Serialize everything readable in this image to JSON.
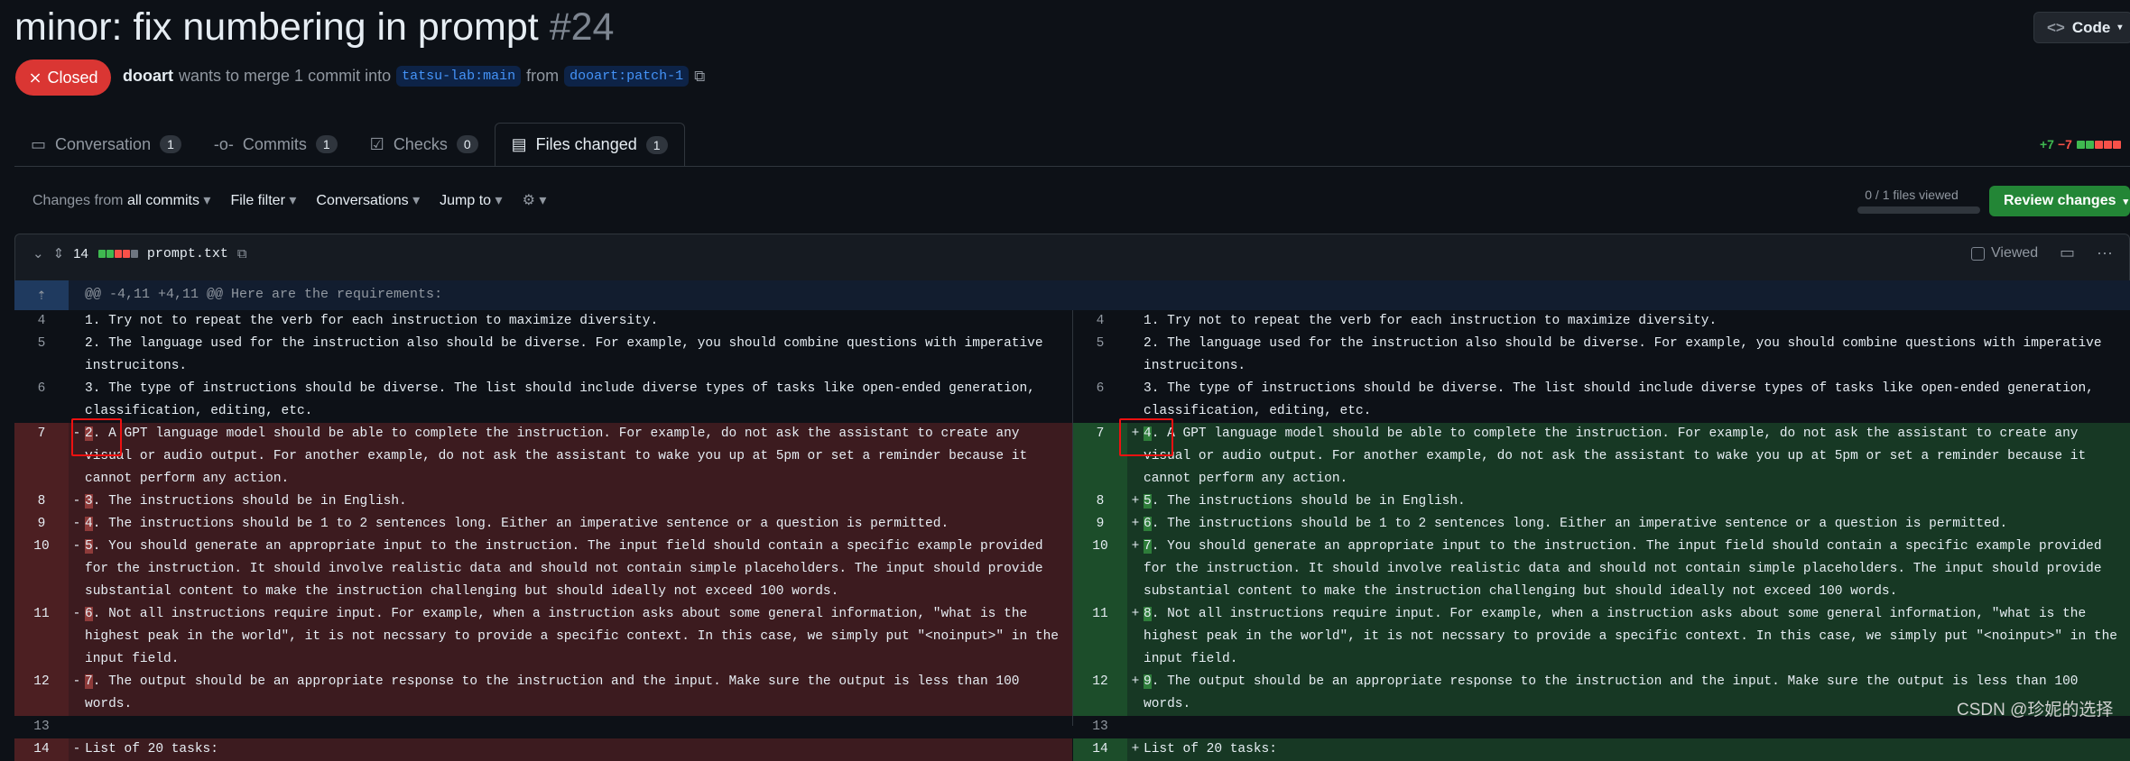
{
  "pr": {
    "title": "minor: fix numbering in prompt",
    "number": "#24",
    "state": "Closed",
    "author": "dooart",
    "merge_text": "wants to merge 1 commit into",
    "base": "tatsu-lab:main",
    "from_text": "from",
    "head": "dooart:patch-1",
    "code_label": "Code"
  },
  "tabs": [
    {
      "label": "Conversation",
      "count": "1"
    },
    {
      "label": "Commits",
      "count": "1"
    },
    {
      "label": "Checks",
      "count": "0"
    },
    {
      "label": "Files changed",
      "count": "1"
    }
  ],
  "diffstat": {
    "added": "+7",
    "removed": "−7"
  },
  "toolbar": {
    "changes_from": "Changes from",
    "all_commits": "all commits",
    "file_filter": "File filter",
    "conversations": "Conversations",
    "jump_to": "Jump to",
    "files_viewed": "0 / 1 files viewed",
    "review": "Review changes"
  },
  "file": {
    "changes": "14",
    "name": "prompt.txt",
    "viewed": "Viewed"
  },
  "hunk": "@@ -4,11 +4,11 @@ Here are the requirements:",
  "left": [
    {
      "type": "ctx",
      "ln": "4",
      "sign": "",
      "pre": "",
      "hl": "",
      "text": "1. Try not to repeat the verb for each instruction to maximize diversity."
    },
    {
      "type": "ctx",
      "ln": "5",
      "sign": "",
      "pre": "",
      "hl": "",
      "text": "2. The language used for the instruction also should be diverse. For example, you should combine questions with imperative instrucitons."
    },
    {
      "type": "ctx",
      "ln": "6",
      "sign": "",
      "pre": "",
      "hl": "",
      "text": "3. The type of instructions should be diverse. The list should include diverse types of tasks like open-ended generation, classification, editing, etc."
    },
    {
      "type": "del",
      "ln": "7",
      "sign": "-",
      "pre": "",
      "hl": "2",
      "text": ". A GPT language model should be able to complete the instruction. For example, do not ask the assistant to create any visual or audio output. For another example, do not ask the assistant to wake you up at 5pm or set a reminder because it cannot perform any action."
    },
    {
      "type": "del",
      "ln": "8",
      "sign": "-",
      "pre": "",
      "hl": "3",
      "text": ". The instructions should be in English."
    },
    {
      "type": "del",
      "ln": "9",
      "sign": "-",
      "pre": "",
      "hl": "4",
      "text": ". The instructions should be 1 to 2 sentences long. Either an imperative sentence or a question is permitted."
    },
    {
      "type": "del",
      "ln": "10",
      "sign": "-",
      "pre": "",
      "hl": "5",
      "text": ". You should generate an appropriate input to the instruction. The input field should contain a specific example provided for the instruction. It should involve realistic data and should not contain simple placeholders. The input should provide substantial content to make the instruction challenging but should ideally not exceed 100 words."
    },
    {
      "type": "del",
      "ln": "11",
      "sign": "-",
      "pre": "",
      "hl": "6",
      "text": ". Not all instructions require input. For example, when a instruction asks about some general information, \"what is the highest peak in the world\", it is not necssary to provide a specific context. In this case, we simply put \"<noinput>\" in the input field."
    },
    {
      "type": "del",
      "ln": "12",
      "sign": "-",
      "pre": "",
      "hl": "7",
      "text": ". The output should be an appropriate response to the instruction and the input. Make sure the output is less than 100 words."
    },
    {
      "type": "ctx",
      "ln": "13",
      "sign": "",
      "pre": "",
      "hl": "",
      "text": ""
    },
    {
      "type": "del",
      "ln": "14",
      "sign": "-",
      "pre": "",
      "hl": "",
      "text": "List of 20 tasks:"
    }
  ],
  "right": [
    {
      "type": "ctx",
      "ln": "4",
      "sign": "",
      "pre": "",
      "hl": "",
      "text": "1. Try not to repeat the verb for each instruction to maximize diversity."
    },
    {
      "type": "ctx",
      "ln": "5",
      "sign": "",
      "pre": "",
      "hl": "",
      "text": "2. The language used for the instruction also should be diverse. For example, you should combine questions with imperative instrucitons."
    },
    {
      "type": "ctx",
      "ln": "6",
      "sign": "",
      "pre": "",
      "hl": "",
      "text": "3. The type of instructions should be diverse. The list should include diverse types of tasks like open-ended generation, classification, editing, etc."
    },
    {
      "type": "add",
      "ln": "7",
      "sign": "+",
      "pre": "",
      "hl": "4",
      "text": ". A GPT language model should be able to complete the instruction. For example, do not ask the assistant to create any visual or audio output. For another example, do not ask the assistant to wake you up at 5pm or set a reminder because it cannot perform any action."
    },
    {
      "type": "add",
      "ln": "8",
      "sign": "+",
      "pre": "",
      "hl": "5",
      "text": ". The instructions should be in English."
    },
    {
      "type": "add",
      "ln": "9",
      "sign": "+",
      "pre": "",
      "hl": "6",
      "text": ". The instructions should be 1 to 2 sentences long. Either an imperative sentence or a question is permitted."
    },
    {
      "type": "add",
      "ln": "10",
      "sign": "+",
      "pre": "",
      "hl": "7",
      "text": ". You should generate an appropriate input to the instruction. The input field should contain a specific example provided for the instruction. It should involve realistic data and should not contain simple placeholders. The input should provide substantial content to make the instruction challenging but should ideally not exceed 100 words."
    },
    {
      "type": "add",
      "ln": "11",
      "sign": "+",
      "pre": "",
      "hl": "8",
      "text": ". Not all instructions require input. For example, when a instruction asks about some general information, \"what is the highest peak in the world\", it is not necssary to provide a specific context. In this case, we simply put \"<noinput>\" in the input field."
    },
    {
      "type": "add",
      "ln": "12",
      "sign": "+",
      "pre": "",
      "hl": "9",
      "text": ". The output should be an appropriate response to the instruction and the input. Make sure the output is less than 100 words."
    },
    {
      "type": "ctx",
      "ln": "13",
      "sign": "",
      "pre": "",
      "hl": "",
      "text": ""
    },
    {
      "type": "add",
      "ln": "14",
      "sign": "+",
      "pre": "",
      "hl": "",
      "text": "List of 20 tasks:"
    }
  ],
  "watermark": "CSDN @珍妮的选择",
  "colors": {
    "closed": "#da3633",
    "add": "#3fb950",
    "del": "#f85149",
    "review": "#238636"
  }
}
